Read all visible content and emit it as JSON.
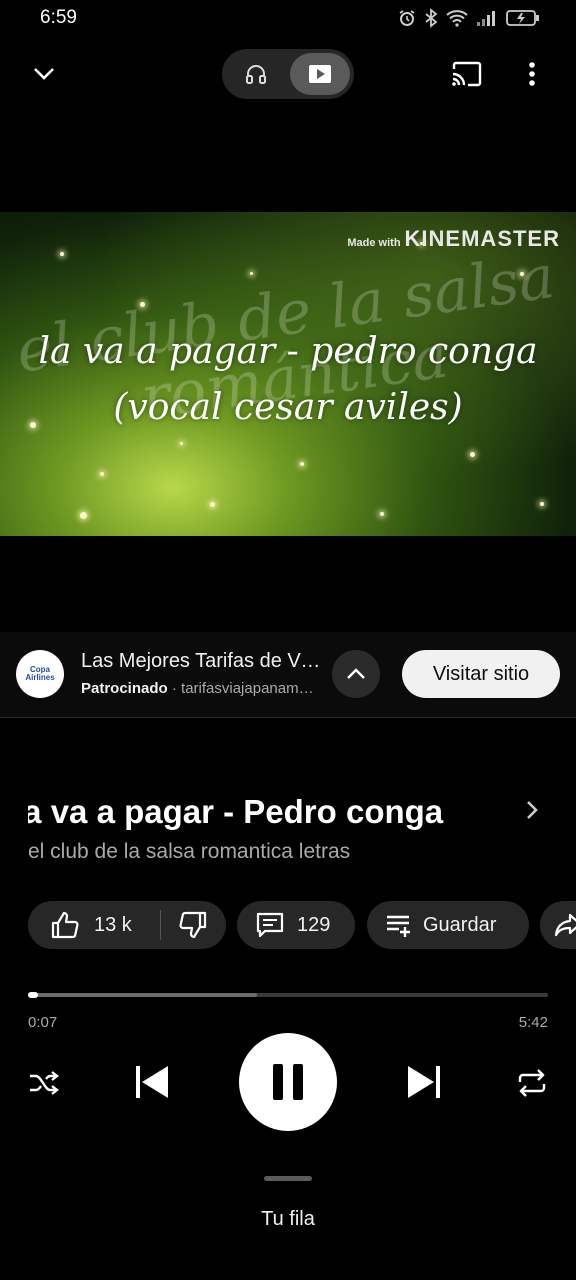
{
  "status_bar": {
    "time": "6:59",
    "icons": [
      "alarm-icon",
      "bluetooth-icon",
      "wifi-icon",
      "signal-icon",
      "battery-charging-icon"
    ]
  },
  "top_bar": {
    "collapse_icon": "chevron-down-icon",
    "mode_audio_icon": "headphones-icon",
    "mode_video_icon": "video-icon",
    "selected_mode": "video",
    "cast_icon": "cast-icon",
    "more_icon": "more-vertical-icon"
  },
  "video": {
    "watermark_small": "Made with",
    "watermark_big": "KINEMASTER",
    "title_line1": "la va a pagar - pedro conga",
    "title_line2": "(vocal cesar aviles)",
    "background_text_line1": "el club de la salsa",
    "background_text_line2": "romántica"
  },
  "ad": {
    "logo_text_line1": "Copa",
    "logo_text_line2": "Airlines",
    "title": "Las Mejores Tarifas de Viajes",
    "sponsored_label": "Patrocinado",
    "separator": " · ",
    "domain": "tarifasviajapanama.com",
    "expand_icon": "chevron-up-icon",
    "visit_label": "Visitar sitio"
  },
  "song": {
    "title": "la va a pagar - Pedro conga",
    "artist": "el club de la salsa romantica letras",
    "chevron_icon": "chevron-right-icon"
  },
  "actions": {
    "like_count": "13 k",
    "like_icon": "thumb-up-icon",
    "dislike_icon": "thumb-down-icon",
    "comments_count": "129",
    "comments_icon": "comment-icon",
    "save_label": "Guardar",
    "save_icon": "playlist-add-icon",
    "share_icon": "share-icon"
  },
  "playback": {
    "current_time": "0:07",
    "total_time": "5:42",
    "played_fraction": 0.02,
    "buffered_fraction": 0.44,
    "state": "playing"
  },
  "controls": {
    "shuffle_icon": "shuffle-icon",
    "previous_icon": "skip-previous-icon",
    "pause_icon": "pause-icon",
    "next_icon": "skip-next-icon",
    "repeat_icon": "repeat-icon"
  },
  "queue": {
    "label": "Tu fila"
  }
}
